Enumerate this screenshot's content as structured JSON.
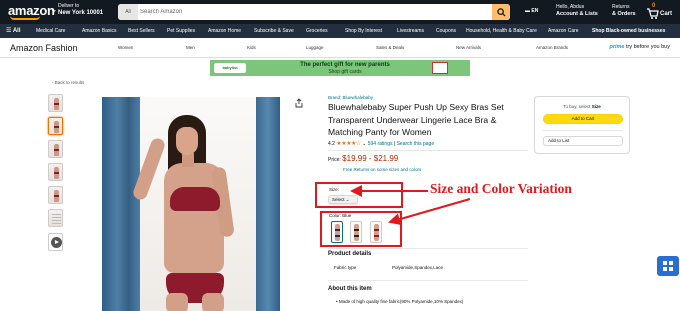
{
  "nav": {
    "logo": "amazon",
    "deliver_line1": "Deliver to",
    "deliver_line2": "New York 10001",
    "search_category": "All",
    "search_placeholder": "Search Amazon",
    "language": "EN",
    "account_line1": "Hello, Abdus",
    "account_line2": "Account & Lists",
    "orders_line1": "Returns",
    "orders_line2": "& Orders",
    "cart_count": "0",
    "cart_label": "Cart",
    "colors": {
      "nav_bg": "#131921",
      "subnav_bg": "#232f3e",
      "search_button": "#febd69",
      "accent": "#ff9900"
    }
  },
  "subnav": {
    "all_label": "All",
    "items": [
      "Medical Care",
      "Amazon Basics",
      "Best Sellers",
      "Pet Supplies",
      "Amazon Home",
      "Subscribe & Save",
      "Groceries",
      "Shop By Interest",
      "Livestreams",
      "Coupons",
      "Household, Health & Baby Care",
      "Amazon Care"
    ],
    "right_label": "Shop Black-owned businesses"
  },
  "store": {
    "title": "Amazon Fashion",
    "items": [
      "Women",
      "Men",
      "Kids",
      "Luggage",
      "Sales & Deals",
      "New Arrivals",
      "Amazon Brands"
    ],
    "prime_word": "prime",
    "prime_text": "try before you buy"
  },
  "banner": {
    "logo_text": "babylist",
    "line1": "The perfect gift for new parents",
    "line2": "Shop gift cards"
  },
  "back_link": "‹ Back to results",
  "product": {
    "brand": "Brand: Bluewhalebaby",
    "title": "Bluewhalebaby Super Push Up Sexy Bras Set Transparent Underwear Lingerie Lace Bra & Matching Panty for Women",
    "rating": "4.2",
    "stars": "★★★★☆",
    "ratings_count": "594 ratings",
    "search_page": "Search this page",
    "price_label": "Price:",
    "price": "$19.99 - $21.99",
    "returns": "Free Returns on some sizes and colors",
    "size_label": "Size:",
    "size_select": "Select",
    "color_label": "Color: Blue",
    "swatches": [
      "Blue",
      "Black",
      "Red"
    ],
    "details_title": "Product details",
    "fabric_label": "Fabric type",
    "fabric_value": "Polyamide,Spandex,Lace",
    "about_title": "About this item",
    "bullet1": "Made of high quality fine fabric(90% Polyamide,10% Spandex)"
  },
  "buybox": {
    "prompt_prefix": "To buy, select",
    "prompt_bold": "Size",
    "add_to_cart": "Add to Cart",
    "add_to_list": "Add to List"
  },
  "annotation": {
    "text": "Size and Color Variation",
    "color": "#e0191c"
  },
  "icons": [
    "menu-icon",
    "location-pin-icon",
    "search-icon",
    "flag-icon",
    "cart-icon",
    "share-icon",
    "play-icon",
    "chevron-down-icon",
    "grid-icon"
  ]
}
